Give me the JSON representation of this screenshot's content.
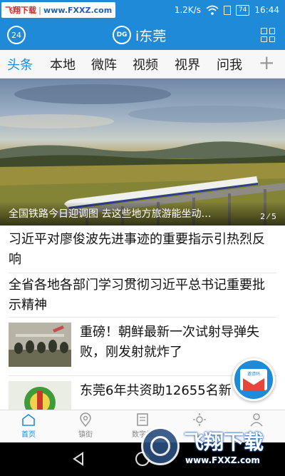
{
  "status_bar": {
    "watermark_name": "飞翔下载",
    "watermark_url": "www.FXXZ.com",
    "speed": "1.2K/s",
    "battery": "74",
    "time": "16:44"
  },
  "header": {
    "weather_badge": "24",
    "logo_text": "DG",
    "title": "i东莞",
    "color": "#1f8ad8"
  },
  "tabs": [
    {
      "label": "头条",
      "active": true
    },
    {
      "label": "本地",
      "active": false
    },
    {
      "label": "微阵",
      "active": false
    },
    {
      "label": "视频",
      "active": false
    },
    {
      "label": "视界",
      "active": false
    },
    {
      "label": "问我",
      "active": false
    }
  ],
  "tab_add": "+",
  "hero": {
    "caption": "全国铁路今日迎调图 去这些地方旅游能坐动…",
    "page_current": "2",
    "page_total": "5"
  },
  "news": [
    {
      "title": "习近平对廖俊波先进事迹的重要指示引热烈反响"
    },
    {
      "title": "全省各地各部门学习贯彻习近平总书记重要批示精神"
    },
    {
      "title": "重磅！朝鲜最新一次试射导弹失败，刚发射就炸了"
    },
    {
      "title": "东莞6年共资助12655名新"
    }
  ],
  "float_button": {
    "label": "邀请码",
    "icon": "envelope-icon"
  },
  "bottom_nav": [
    {
      "label": "首页",
      "icon": "home-icon",
      "active": true
    },
    {
      "label": "镇街",
      "icon": "location-icon",
      "active": false
    },
    {
      "label": "数字报",
      "icon": "newspaper-icon",
      "active": false
    },
    {
      "label": "",
      "icon": "sun-icon",
      "active": false
    },
    {
      "label": "",
      "icon": "user-icon",
      "active": false
    }
  ],
  "watermark_bottom": {
    "title": "飞翔下载",
    "url": "www.FXXZ.com"
  }
}
